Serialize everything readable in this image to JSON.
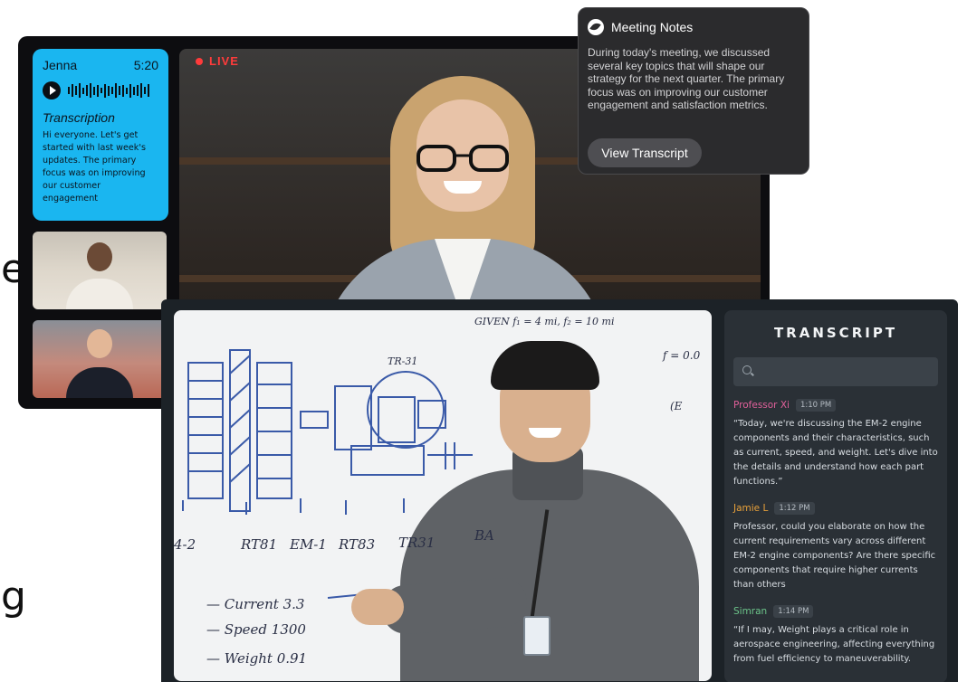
{
  "background_fragments": [
    "e",
    "g"
  ],
  "meeting": {
    "live_label": "LIVE",
    "transcription_card": {
      "name": "Jenna",
      "time": "5:20",
      "label": "Transcription",
      "text": "Hi everyone. Let's get started with last week's updates. The primary focus was on improving our customer engagement",
      "accent": "#1ab6f0"
    },
    "notes": {
      "title": "Meeting Notes",
      "body": "During today's meeting, we discussed several key topics that will shape our strategy for the next quarter. The primary focus was on improving our customer engagement and satisfaction metrics.",
      "button_label": "View Transcript"
    }
  },
  "lecture": {
    "board": {
      "top_text": "GIVEN  f₁ = 4 mi,  f₂ = 10 mi",
      "labels": [
        "4-2",
        "RT81",
        "EM-1",
        "RT83",
        "TR31",
        "BA"
      ],
      "notes": [
        "— Current 3.3",
        "— Speed 1300",
        "— Weight 0.91"
      ],
      "side_marks": [
        "f = 0.0",
        "(E",
        "TR-31"
      ]
    },
    "transcript": {
      "title": "TRANSCRIPT",
      "search_placeholder": "",
      "entries": [
        {
          "speaker": "Professor Xi",
          "time": "1:10 PM",
          "color": "#e0609a",
          "text": "“Today, we're discussing the EM-2 engine components and their characteristics, such as current, speed, and weight. Let's dive into the details and understand how each part functions.”"
        },
        {
          "speaker": "Jamie L",
          "time": "1:12 PM",
          "color": "#e8a13a",
          "text": "Professor, could you elaborate on how the current requirements vary across different EM-2 engine components? Are there specific components that require higher currents than others"
        },
        {
          "speaker": "Simran",
          "time": "1:14 PM",
          "color": "#6cc48a",
          "text": "“If I may, Weight plays a critical role in aerospace engineering, affecting everything from fuel efficiency to maneuverability."
        }
      ]
    }
  }
}
